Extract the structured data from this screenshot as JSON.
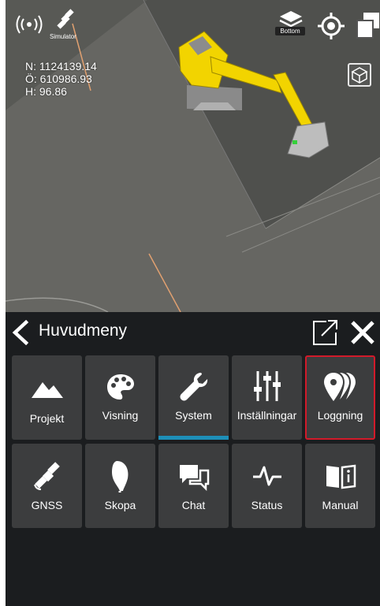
{
  "hud": {
    "simulator_label": "Simulator",
    "layer_label": "Bottom",
    "coords": {
      "north": "N: 1124139.14",
      "east": "Ö: 610986.93",
      "height": "H: 96.86"
    },
    "icons": [
      "signal-icon",
      "satellite-icon",
      "layers-icon",
      "locate-icon",
      "window-icon",
      "cube-icon"
    ]
  },
  "menu": {
    "title": "Huvudmeny",
    "tiles": [
      {
        "label": "Projekt",
        "icon": "mountain-icon"
      },
      {
        "label": "Visning",
        "icon": "palette-icon"
      },
      {
        "label": "System",
        "icon": "wrench-icon"
      },
      {
        "label": "Inställningar",
        "icon": "sliders-icon"
      },
      {
        "label": "Loggning",
        "icon": "pins-icon"
      },
      {
        "label": "GNSS",
        "icon": "satellite-icon"
      },
      {
        "label": "Skopa",
        "icon": "bucket-icon"
      },
      {
        "label": "Chat",
        "icon": "chat-icon"
      },
      {
        "label": "Status",
        "icon": "pulse-icon"
      },
      {
        "label": "Manual",
        "icon": "book-info-icon"
      }
    ],
    "active_tab": "System",
    "highlighted": "Loggning"
  },
  "colors": {
    "active_tab": "#1e8fb8",
    "highlight": "#d21a2a",
    "tile_bg": "#3c3d3e",
    "panel_bg": "#1b1d1f",
    "machine": "#f2d400"
  }
}
